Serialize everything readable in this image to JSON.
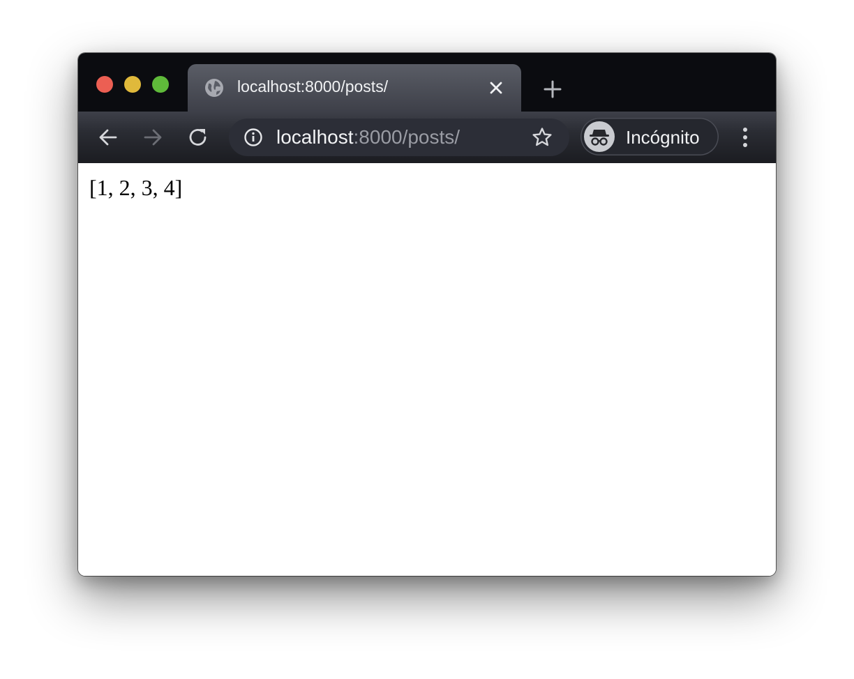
{
  "window": {
    "traffic_lights": {
      "close_color": "#ec5f53",
      "minimize_color": "#e0b93b",
      "zoom_color": "#5fba3a"
    }
  },
  "tabs": [
    {
      "title": "localhost:8000/posts/",
      "icon": "globe-icon",
      "active": true
    }
  ],
  "toolbar": {
    "icons": [
      "back-arrow-icon",
      "forward-arrow-icon",
      "reload-icon",
      "info-icon",
      "star-icon",
      "incognito-icon",
      "kebab-menu-icon"
    ],
    "address": {
      "host": "localhost",
      "rest": ":8000/posts/"
    },
    "profile_label": "Incógnito"
  },
  "page": {
    "body_text": "[1, 2, 3, 4]"
  }
}
